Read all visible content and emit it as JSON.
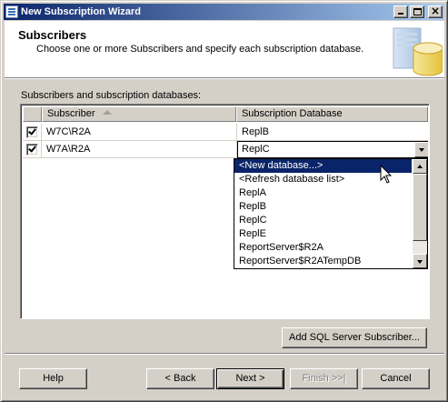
{
  "window": {
    "title": "New Subscription Wizard"
  },
  "header": {
    "title": "Subscribers",
    "subtitle": "Choose one or more Subscribers and specify each subscription database."
  },
  "grid": {
    "label": "Subscribers and subscription databases:",
    "columns": [
      "Subscriber",
      "Subscription Database"
    ],
    "rows": [
      {
        "checked": true,
        "subscriber": "W7C\\R2A",
        "database": "ReplB"
      },
      {
        "checked": true,
        "subscriber": "W7A\\R2A",
        "database": "ReplC"
      }
    ]
  },
  "dropdown": {
    "items": [
      "<New database...>",
      "<Refresh database list>",
      "ReplA",
      "ReplB",
      "ReplC",
      "ReplE",
      "ReportServer$R2A",
      "ReportServer$R2ATempDB"
    ],
    "selected_index": 0
  },
  "buttons": {
    "add_subscriber": "Add SQL Server Subscriber...",
    "help": "Help",
    "back": "< Back",
    "next": "Next >",
    "finish": "Finish >>|",
    "cancel": "Cancel"
  },
  "colors": {
    "title_bar": "#0a246a",
    "selection": "#0a246a",
    "face": "#d4d0c8"
  }
}
